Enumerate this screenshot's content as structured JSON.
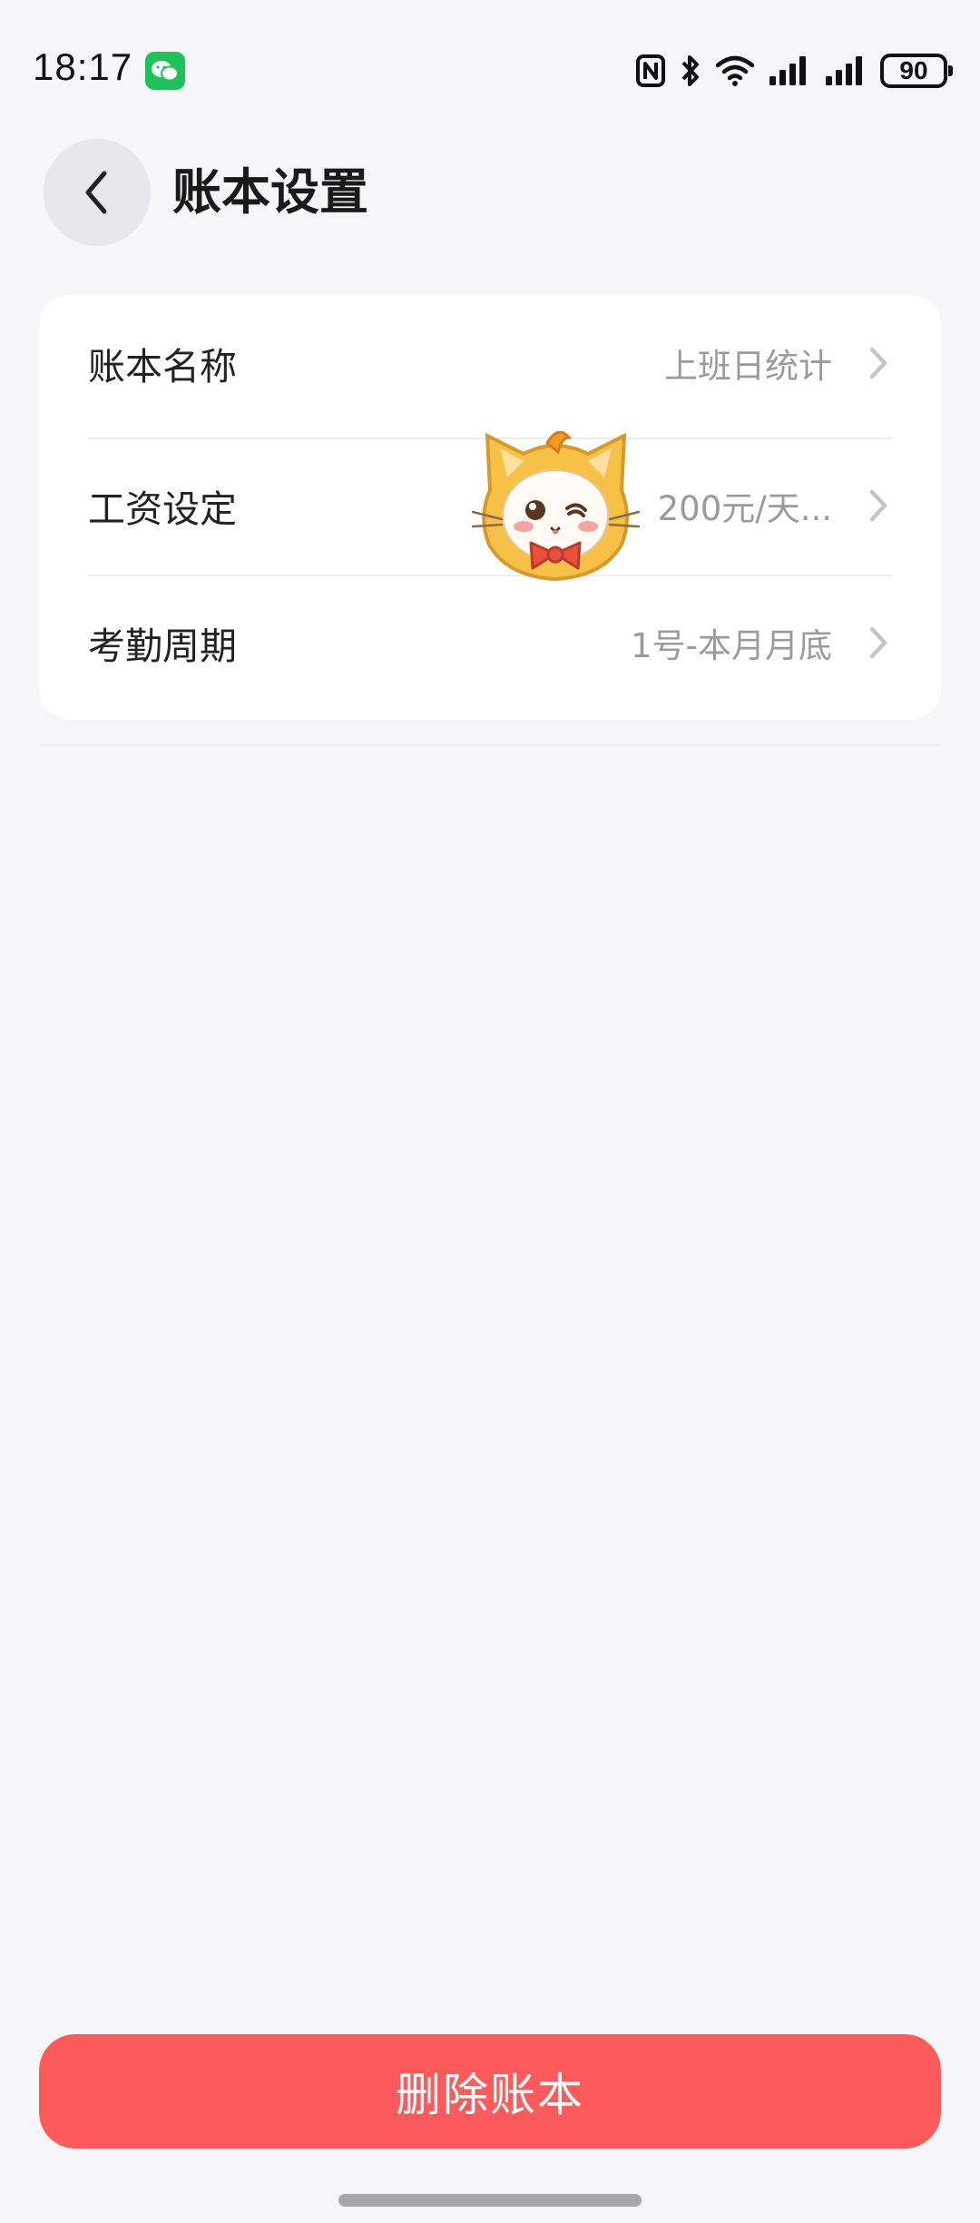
{
  "status_bar": {
    "time": "18:17",
    "battery": "90",
    "icons": [
      "wechat-icon",
      "nfc-icon",
      "bluetooth-icon",
      "wifi-icon",
      "signal-icon",
      "signal-icon",
      "battery-icon"
    ]
  },
  "header": {
    "title": "账本设置",
    "back_icon": "chevron-left-icon"
  },
  "settings": {
    "items": [
      {
        "label": "账本名称",
        "value": "上班日统计"
      },
      {
        "label": "工资设定",
        "value": "200元/天..."
      },
      {
        "label": "考勤周期",
        "value": "1号-本月月底"
      }
    ]
  },
  "footer": {
    "delete_label": "删除账本"
  },
  "colors": {
    "background": "#f6f6f9",
    "card": "#ffffff",
    "danger": "#fd5a5c",
    "secondary_text": "#9a9a9a"
  }
}
